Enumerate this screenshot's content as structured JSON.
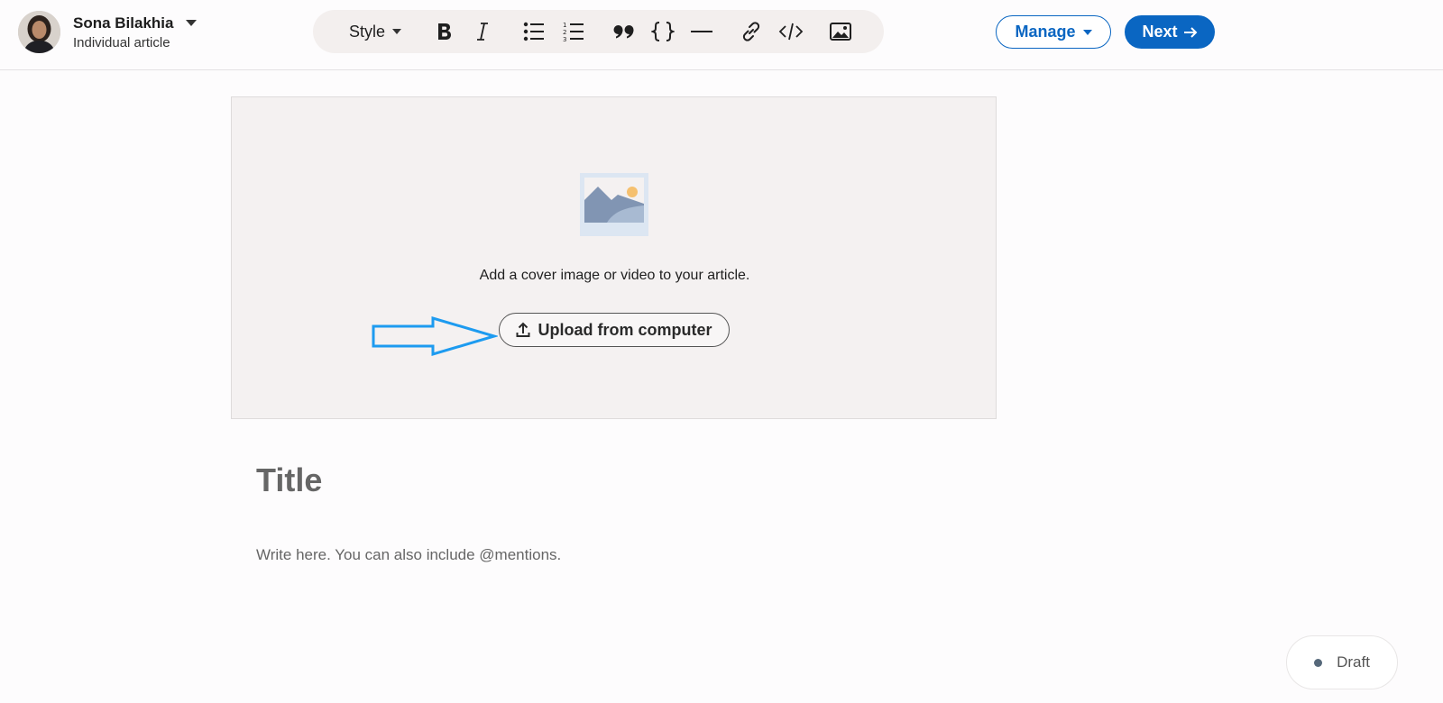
{
  "author": {
    "name": "Sona Bilakhia",
    "subtitle": "Individual article"
  },
  "toolbar": {
    "style_label": "Style",
    "buttons": [
      "bold-icon",
      "italic-icon",
      "bullet-list-icon",
      "numbered-list-icon",
      "quote-icon",
      "code-braces-icon",
      "divider-icon",
      "link-icon",
      "embed-code-icon",
      "image-icon"
    ]
  },
  "actions": {
    "manage_label": "Manage",
    "next_label": "Next"
  },
  "cover": {
    "prompt": "Add a cover image or video to your article.",
    "upload_label": "Upload from computer"
  },
  "editor": {
    "title_placeholder": "Title",
    "body_placeholder": "Write here. You can also include @mentions."
  },
  "status": {
    "label": "Draft"
  },
  "colors": {
    "brand": "#0a66c2",
    "annotation_arrow": "#1d9bf0"
  }
}
